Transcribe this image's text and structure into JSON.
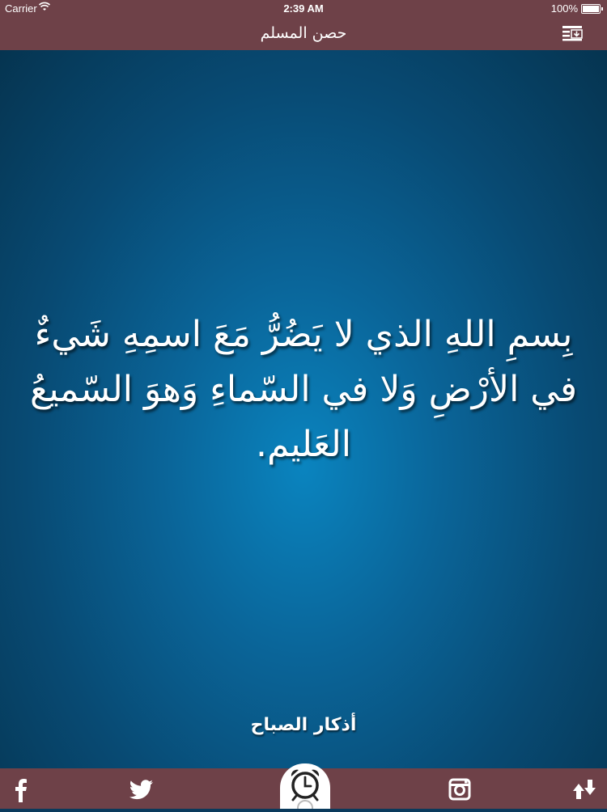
{
  "status_bar": {
    "carrier": "Carrier",
    "time": "2:39 AM",
    "battery": "100%",
    "battery_level": 1.0
  },
  "nav": {
    "title": "حصن المسلم",
    "menu_icon": "list-download-icon"
  },
  "content": {
    "dhikr_text": "بِسمِ اللهِ الذي لا يَضُرُّ مَعَ اسمِهِ شَيءٌ في الأرْضِ وَلا في السّماءِ وَهوَ السّميعُ العَليم.",
    "section_label": "أذكار الصباح"
  },
  "bottom_bar": {
    "icons": [
      "facebook-icon",
      "twitter-icon",
      "alarm-clock-icon",
      "instagram-icon",
      "share-icon"
    ]
  },
  "colors": {
    "bar": "#6e4148",
    "background_center": "#0a84bf",
    "background_edge": "#053450",
    "text": "#ffffff"
  }
}
